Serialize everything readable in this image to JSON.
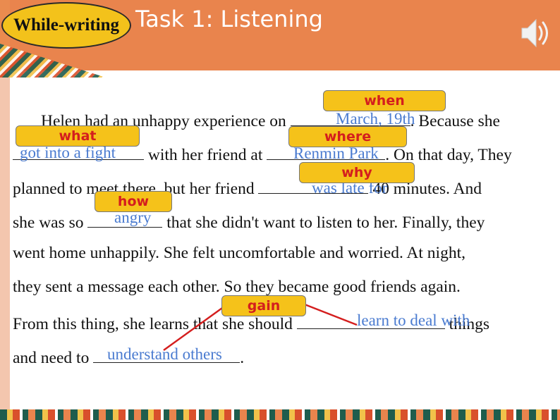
{
  "header": {
    "badge": "While-writing",
    "title": "Task 1: Listening",
    "audio_icon": "speaker-icon"
  },
  "passage": {
    "l1a": "Helen had an unhappy experience on",
    "l1b": ". Because she",
    "l2a": "with her friend at",
    "l2b": ". On that day, They",
    "l3a": "planned to meet there, but her friend",
    "l3b": "40 minutes. And",
    "l4a": "she was so",
    "l4b": "that she didn't want to listen to her. Finally, they",
    "l5": "went home unhappily. She felt uncomfortable and worried. At night,",
    "l6": "they sent a message each other. So they became good friends again.",
    "l7a": "From this thing, she learns that she should",
    "l7b": "things",
    "l8a": "and need to",
    "l8b": "."
  },
  "answers": {
    "a1": "March, 19th",
    "a2": "got into a fight",
    "a3": "Renmin Park",
    "a4": "was late for",
    "a5": "angry",
    "a6": "learn to deal with",
    "a7": "understand others"
  },
  "tags": {
    "when": "when",
    "what": "what",
    "where": "where",
    "why": "why",
    "how": "how",
    "gain": "gain"
  },
  "colors": {
    "header": "#e9844d",
    "badge": "#f3c21b",
    "answer": "#4a7bd0",
    "tag_text": "#d41e1e",
    "arrow": "#d41e1e"
  }
}
